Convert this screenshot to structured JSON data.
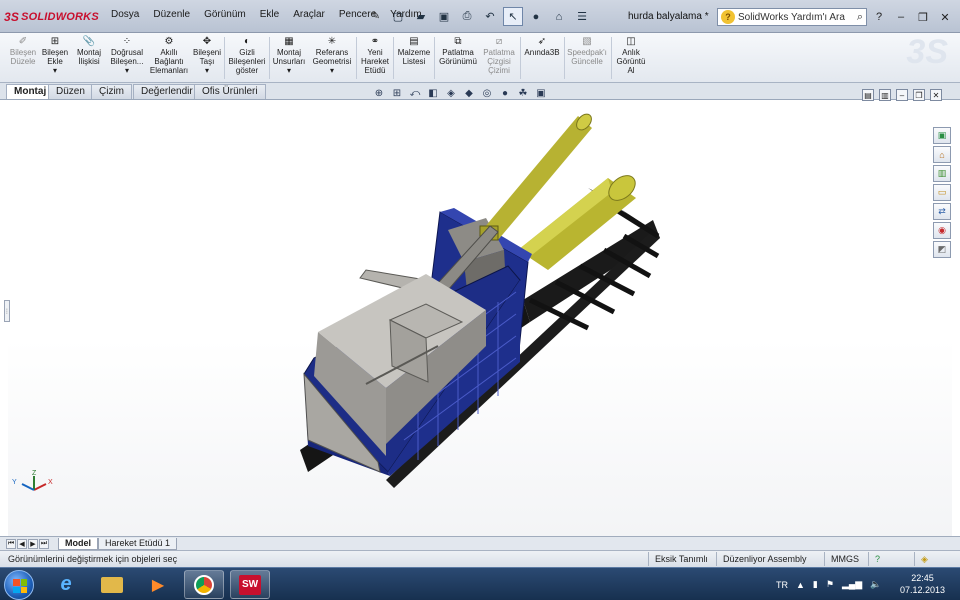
{
  "app": {
    "logo": "SOLIDWORKS",
    "document_title": "hurda balyalama *"
  },
  "menu": [
    "Dosya",
    "Düzenle",
    "Görünüm",
    "Ekle",
    "Araçlar",
    "Pencere",
    "Yardım"
  ],
  "help_search": {
    "placeholder": "SolidWorks Yardım'ı Ara"
  },
  "ribbon": [
    {
      "label": "Bileşen\nDüzele",
      "disabled": true,
      "icon": "edit-component-icon"
    },
    {
      "label": "Bileşen\nEkle",
      "icon": "insert-component-icon"
    },
    {
      "label": "Montaj\nİlişkisi",
      "icon": "mate-icon"
    },
    {
      "label": "Doğrusal\nBileşen...",
      "icon": "linear-pattern-icon"
    },
    {
      "label": "Akıllı\nBağlantı\nElemanları",
      "icon": "smart-fasteners-icon"
    },
    {
      "label": "Bileşeni\nTaşı",
      "icon": "move-component-icon"
    },
    {
      "label": "Gizli\nBileşenleri\ngöster",
      "icon": "show-hidden-icon"
    },
    {
      "label": "Montaj\nUnsurları",
      "icon": "assembly-features-icon"
    },
    {
      "label": "Referans\nGeometrisi",
      "icon": "reference-geometry-icon"
    },
    {
      "label": "Yeni\nHareket\nEtüdü",
      "icon": "new-motion-study-icon"
    },
    {
      "label": "Malzeme\nListesi",
      "icon": "bom-icon"
    },
    {
      "label": "Patlatma\nGörünümü",
      "icon": "exploded-view-icon"
    },
    {
      "label": "Patlatma\nÇizgisi\nÇizimi",
      "disabled": true,
      "icon": "explode-line-icon"
    },
    {
      "label": "Anında3B",
      "icon": "instant3d-icon"
    },
    {
      "label": "Speedpak'ı\nGüncelle",
      "disabled": true,
      "icon": "speedpak-icon"
    },
    {
      "label": "Anlık\nGörüntü\nAl",
      "icon": "snapshot-icon"
    }
  ],
  "tabs": [
    "Montaj",
    "Düzen",
    "Çizim",
    "Değerlendir",
    "Ofis Ürünleri"
  ],
  "bottom_tabs": [
    "Model",
    "Hareket Etüdü 1"
  ],
  "status": {
    "message": "Görünümlerini değiştirmek için objeleri seç",
    "definition": "Eksik Tanımlı",
    "mode": "Düzenliyor Assembly",
    "units": "MMGS"
  },
  "triad": {
    "x": "X",
    "y": "Y",
    "z": "Z"
  },
  "tray": {
    "lang": "TR",
    "time": "22:45",
    "date": "07.12.2013"
  },
  "colors": {
    "frame_blue": "#1e2f8c",
    "cylinder_yellow": "#b9b530",
    "steel_gray": "#9c9a96",
    "black_frame": "#151515"
  }
}
